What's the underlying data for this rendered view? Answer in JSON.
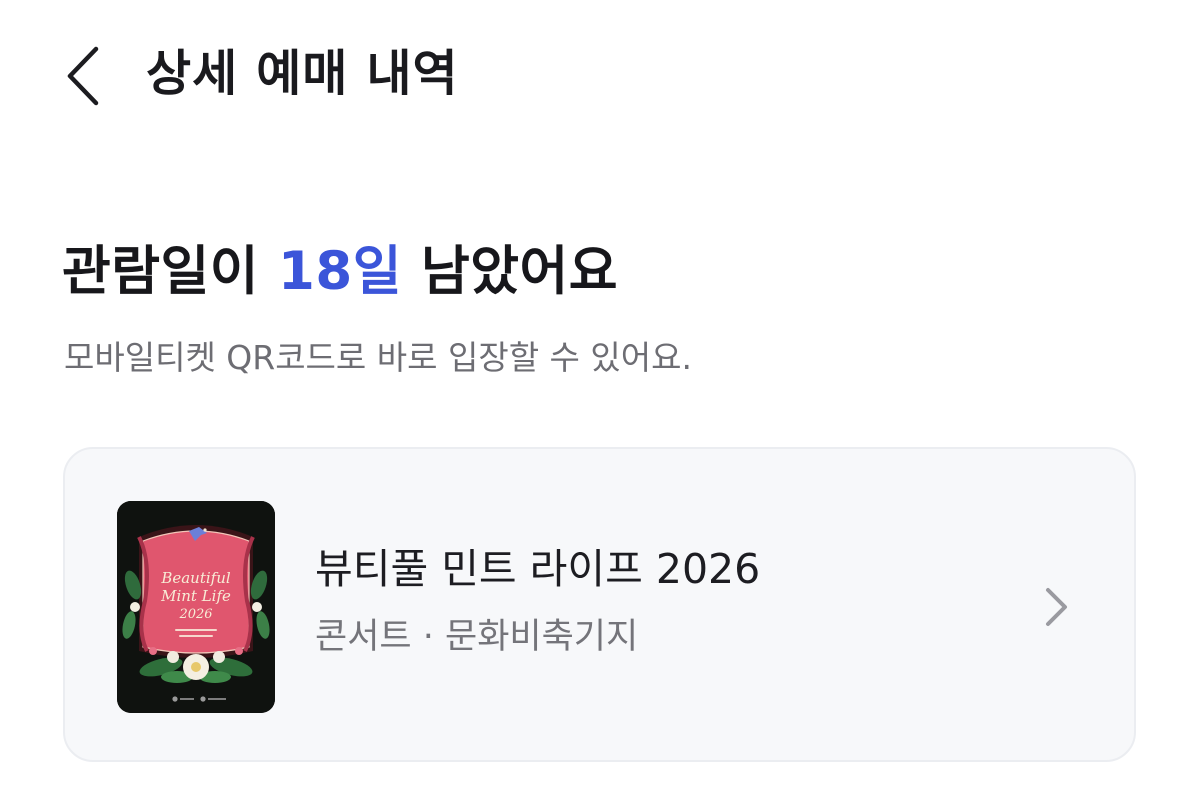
{
  "header": {
    "title": "상세 예매 내역",
    "back_icon": "chevron-left-icon"
  },
  "summary": {
    "headline_prefix": "관람일이 ",
    "days_left": "18일",
    "headline_suffix": " 남았어요",
    "subtext": "모바일티켓 QR코드로 바로 입장할 수 있어요."
  },
  "ticket": {
    "title": "뷰티풀 민트 라이프 2026",
    "category": "콘서트",
    "separator": " · ",
    "venue": "문화비축기지",
    "poster": {
      "line1": "Beautiful",
      "line2": "Mint Life",
      "line3": "2026"
    },
    "chevron_icon": "chevron-right-icon"
  },
  "colors": {
    "accent": "#3b55d9",
    "card_background": "#f7f8fa",
    "poster_pink": "#e0566e"
  }
}
